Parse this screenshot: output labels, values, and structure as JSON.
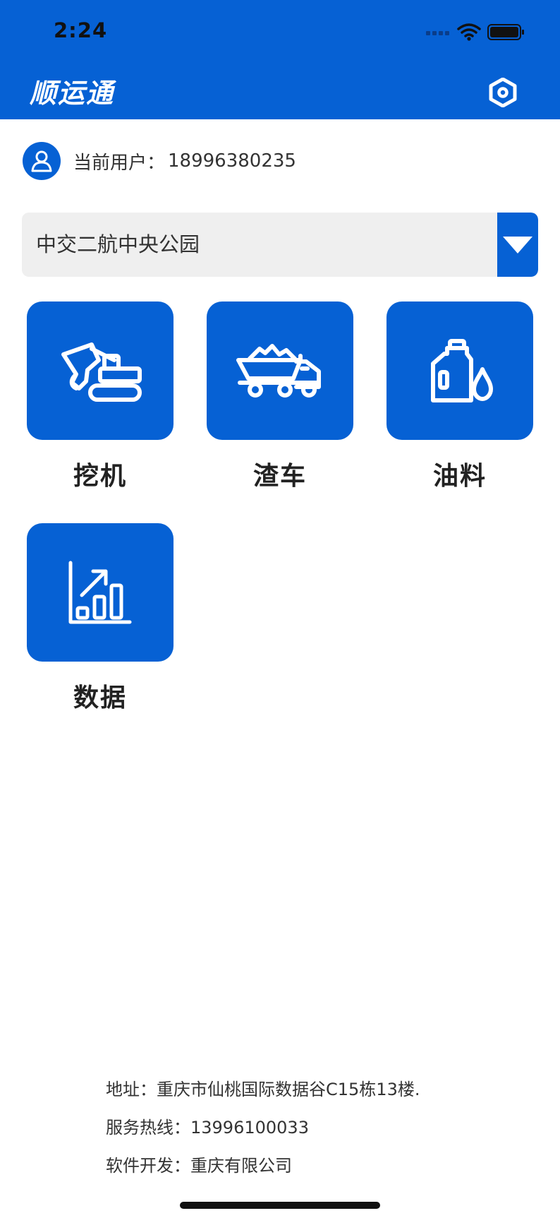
{
  "status_bar": {
    "time": "2:24"
  },
  "header": {
    "title": "顺运通"
  },
  "user": {
    "label": "当前用户：",
    "phone": "18996380235"
  },
  "project_selector": {
    "selected": "中交二航中央公园"
  },
  "tiles": [
    {
      "label": "挖机",
      "icon": "excavator-icon"
    },
    {
      "label": "渣车",
      "icon": "dump-truck-icon"
    },
    {
      "label": "油料",
      "icon": "oil-can-icon"
    },
    {
      "label": "数据",
      "icon": "bar-chart-icon"
    }
  ],
  "footer": {
    "address": "地址：重庆市仙桃国际数据谷C15栋13楼.",
    "hotline": "服务热线：13996100033",
    "developer": "软件开发：重庆有限公司"
  },
  "colors": {
    "brand": "#0661d4",
    "select_bg": "#efefef",
    "text": "#333333"
  }
}
